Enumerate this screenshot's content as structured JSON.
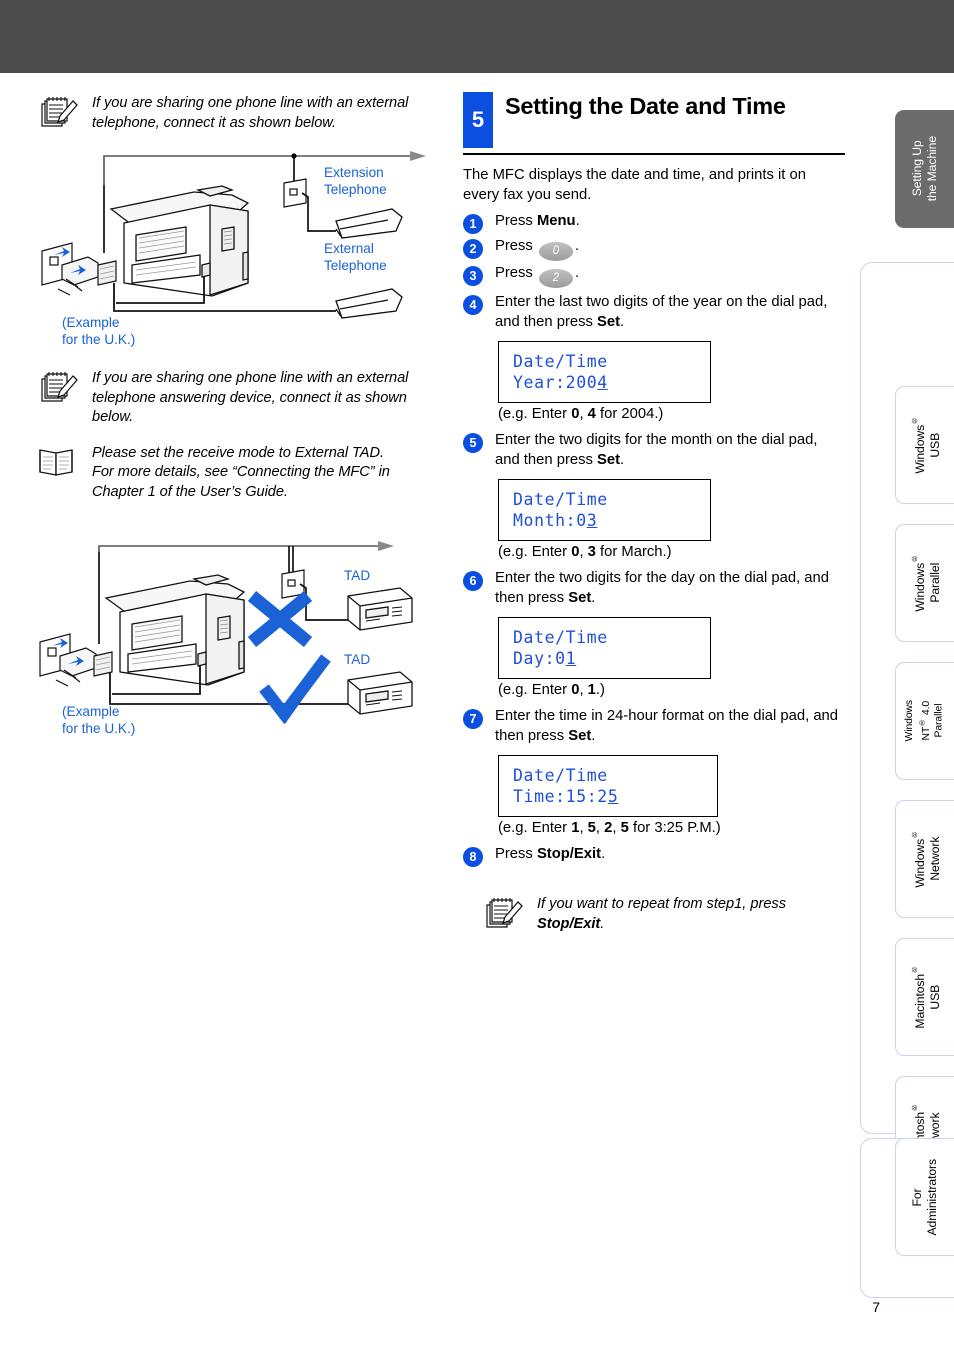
{
  "page": {
    "number": "7",
    "band_color": "#4b4b4b",
    "accent_blue": "#0a4fe0",
    "lcd_text_color": "#1f4fd8",
    "diagram_label_color": "#1a62d6"
  },
  "left": {
    "note1": {
      "icon": "notepad-pencil-icon",
      "text": "If you are sharing one phone line with an external telephone, connect it as shown below."
    },
    "diagram1": {
      "labels": {
        "extension": "Extension\nTelephone",
        "external": "External\nTelephone",
        "example": "(Example\nfor the U.K.)"
      }
    },
    "note2": {
      "icon": "notepad-pencil-icon",
      "text": "If you are sharing one phone line with an external telephone answering device, connect it as shown below."
    },
    "note3": {
      "icon": "open-book-icon",
      "text": "Please set the receive mode to External TAD.\nFor more details, see “Connecting the MFC” in Chapter 1 of the User’s Guide."
    },
    "diagram2": {
      "labels": {
        "tad_bad": "TAD",
        "tad_good": "TAD",
        "example": "(Example\nfor the U.K.)"
      },
      "marks": {
        "cross": "wrong-connection-mark",
        "check": "correct-connection-mark"
      }
    }
  },
  "section": {
    "number": "5",
    "title": "Setting the Date and Time",
    "intro": "The MFC displays the date and time, and prints it on every fax you send.",
    "steps": [
      {
        "n": "1",
        "html": "Press <b>Menu</b>."
      },
      {
        "n": "2",
        "html": "Press <span class=\"keycap\" data-name=\"keycap-0\" data-interactable=\"true\">0</span>."
      },
      {
        "n": "3",
        "html": "Press <span class=\"keycap\" data-name=\"keycap-2\" data-interactable=\"true\">2</span>."
      },
      {
        "n": "4",
        "html": "Enter the last two digits of the year on the dial pad, and then press <b>Set</b>."
      },
      {
        "n": "5",
        "html": "Enter the two digits for the month on the dial pad, and then press <b>Set</b>."
      },
      {
        "n": "6",
        "html": "Enter the two digits for the day on the dial pad, and then press <b>Set</b>."
      },
      {
        "n": "7",
        "html": "Enter the time in 24-hour format on the dial pad, and then press <b>Set</b>."
      },
      {
        "n": "8",
        "html": "Press <b>Stop/Exit</b>."
      }
    ],
    "lcd": [
      {
        "line1": "Date/Time",
        "line2_pre": "Year:200",
        "line2_cursor": "4"
      },
      {
        "line1": "Date/Time",
        "line2_pre": "Month:0",
        "line2_cursor": "3"
      },
      {
        "line1": "Date/Time",
        "line2_pre": "Day:0",
        "line2_cursor": "1"
      },
      {
        "line1": "Date/Time",
        "line2_pre": "Time:15:2",
        "line2_cursor": "5"
      }
    ],
    "examples": [
      "(e.g. Enter <b>0</b>, <b>4</b> for 2004.)",
      "(e.g. Enter <b>0</b>, <b>3</b> for March.)",
      "(e.g. Enter <b>0</b>, <b>1</b>.)",
      "(e.g. Enter <b>1</b>, <b>5</b>, <b>2</b>, <b>5</b> for 3:25 P.M.)"
    ],
    "tip": {
      "icon": "notepad-pencil-icon",
      "html": "If you want to repeat from step1, press <b>Stop/Exit</b>."
    }
  },
  "tabs": [
    {
      "id": "setting-up-the-machine",
      "label": "Setting Up\nthe Machine",
      "active": true,
      "sup": false
    },
    {
      "id": "windows-usb",
      "label": "Windows\n USB",
      "active": false,
      "sup": true,
      "line1": "Windows",
      "line2": "USB"
    },
    {
      "id": "windows-parallel",
      "label": "Windows\n Parallel",
      "active": false,
      "sup": true,
      "line1": "Windows",
      "line2": "Parallel"
    },
    {
      "id": "windows-nt-40-parallel",
      "label": "Windows\nNT 4.0\nParallel",
      "active": false,
      "sup": true,
      "line1": "Windows",
      "line2": "NT",
      "line3": "4.0",
      "line4": "Parallel"
    },
    {
      "id": "windows-network",
      "label": "Windows\n Network",
      "active": false,
      "sup": true,
      "line1": "Windows",
      "line2": "Network"
    },
    {
      "id": "macintosh-usb",
      "label": "Macintosh\n USB",
      "active": false,
      "sup": true,
      "line1": "Macintosh",
      "line2": "USB"
    },
    {
      "id": "macintosh-network",
      "label": "Macintosh\n Network",
      "active": false,
      "sup": true,
      "line1": "Macintosh",
      "line2": "Network"
    },
    {
      "id": "for-administrators",
      "label": "For\nAdministrators",
      "active": false,
      "sup": false
    }
  ]
}
